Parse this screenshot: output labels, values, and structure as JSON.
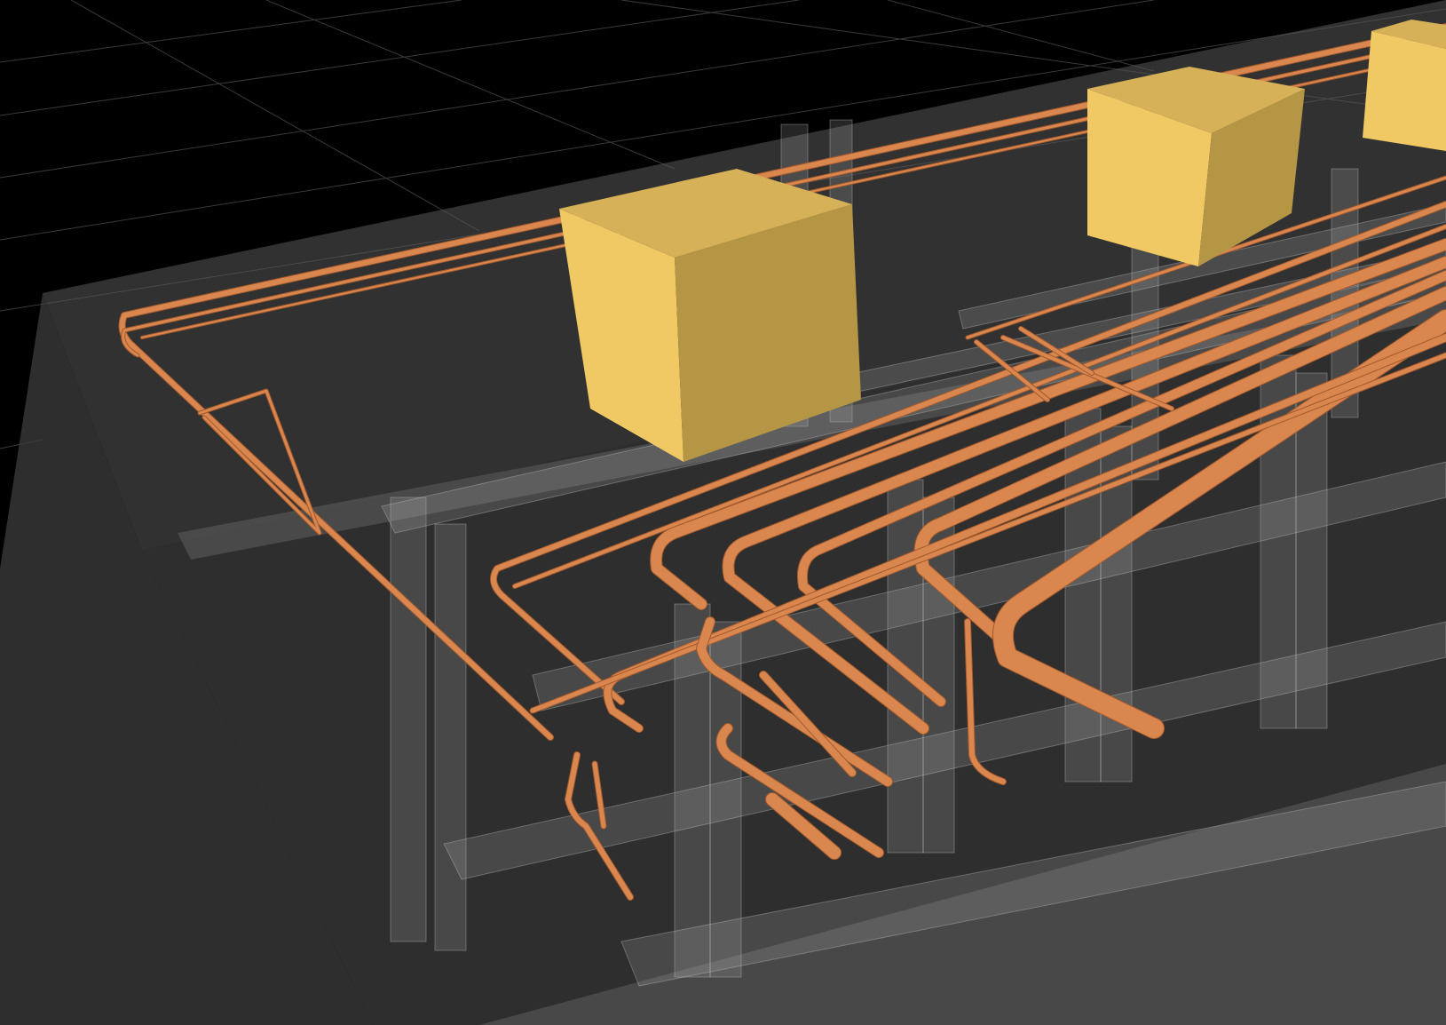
{
  "scene": {
    "type": "3d-viewport",
    "content": "piping-rack-model",
    "background_color": "#000000",
    "grid_color": "#3a3a3a",
    "structure_color": "#9a9a9a",
    "pipe_color": "#d9864f",
    "pipe_shadow_color": "#a35a2c",
    "equipment_color": "#f0c864",
    "equipment_side_color": "#b59645",
    "equipment_top_color": "#d6b157"
  }
}
